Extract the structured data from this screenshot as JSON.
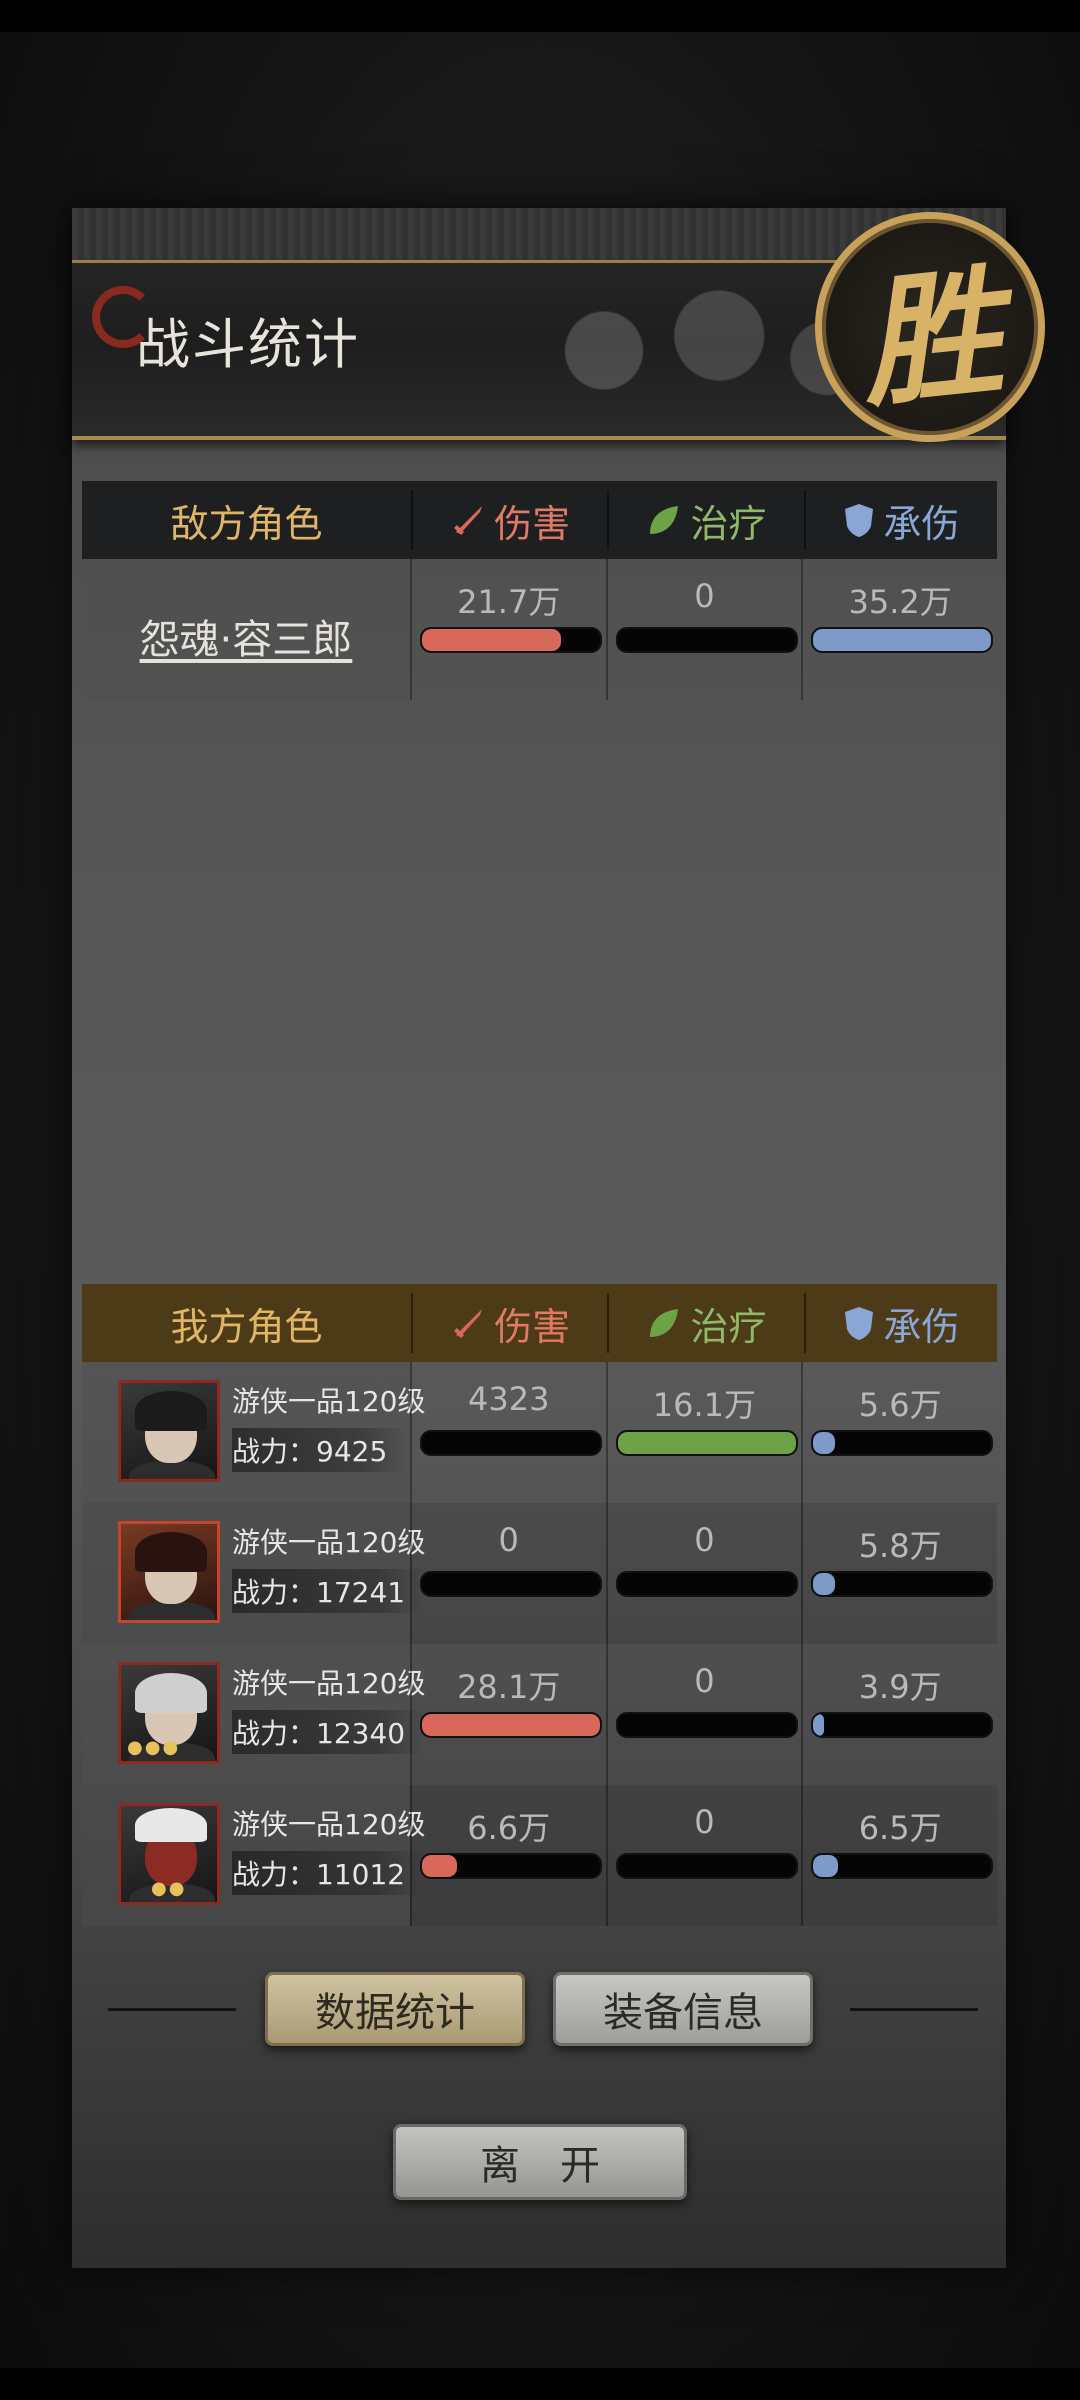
{
  "title": "战斗统计",
  "result_badge": "胜",
  "columns": {
    "damage": "伤害",
    "heal": "治疗",
    "tank": "承伤"
  },
  "enemy": {
    "header": "敌方角色",
    "rows": [
      {
        "name": "怨魂·容三郎",
        "damage": "21.7万",
        "heal": "0",
        "tank": "35.2万",
        "damage_fill": 0.78,
        "heal_fill": 0,
        "tank_fill": 1.0
      }
    ]
  },
  "ally": {
    "header": "我方角色",
    "rows": [
      {
        "title": "游侠一品120级",
        "power": "战力：9425",
        "damage": "4323",
        "heal": "16.1万",
        "tank": "5.6万",
        "damage_fill": 0,
        "heal_fill": 1.0,
        "tank_fill": 0.12,
        "stars": 0,
        "icon": "portrait-hooded-man-icon"
      },
      {
        "title": "游侠一品120级",
        "power": "战力：17241",
        "damage": "0",
        "heal": "0",
        "tank": "5.8万",
        "damage_fill": 0,
        "heal_fill": 0,
        "tank_fill": 0.12,
        "stars": 0,
        "icon": "portrait-woman-icon"
      },
      {
        "title": "游侠一品120级",
        "power": "战力：12340",
        "damage": "28.1万",
        "heal": "0",
        "tank": "3.9万",
        "damage_fill": 1.0,
        "heal_fill": 0,
        "tank_fill": 0.06,
        "stars": 3,
        "icon": "portrait-silver-hair-icon"
      },
      {
        "title": "游侠一品120级",
        "power": "战力：11012",
        "damage": "6.6万",
        "heal": "0",
        "tank": "6.5万",
        "damage_fill": 0.2,
        "heal_fill": 0,
        "tank_fill": 0.14,
        "stars": 2,
        "icon": "portrait-demon-icon"
      }
    ]
  },
  "buttons": {
    "stats": "数据统计",
    "equipment": "装备信息",
    "leave": "离开"
  },
  "colors": {
    "damage": "#d8685a",
    "heal": "#6ea246",
    "tank": "#7d9ac8",
    "gold": "#e0b565"
  }
}
